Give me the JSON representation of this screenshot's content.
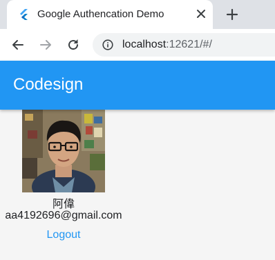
{
  "browser": {
    "tab": {
      "title": "Google Authencation Demo",
      "favicon": "flutter-icon",
      "close_icon": "close-icon"
    },
    "new_tab_icon": "plus-icon",
    "toolbar": {
      "back_icon": "back-arrow-icon",
      "forward_icon": "forward-arrow-icon",
      "reload_icon": "reload-icon",
      "info_icon": "info-icon"
    },
    "address": {
      "host": "localhost",
      "rest": ":12621/#/"
    }
  },
  "app": {
    "title": "Codesign",
    "user": {
      "name": "阿偉",
      "email": "aa4192696@gmail.com",
      "avatar": "profile-photo"
    },
    "logout_label": "Logout"
  },
  "colors": {
    "primary": "#2196f3",
    "tabstrip": "#dee1e6",
    "omnibox": "#f1f3f4",
    "background": "#f5f5f5"
  }
}
